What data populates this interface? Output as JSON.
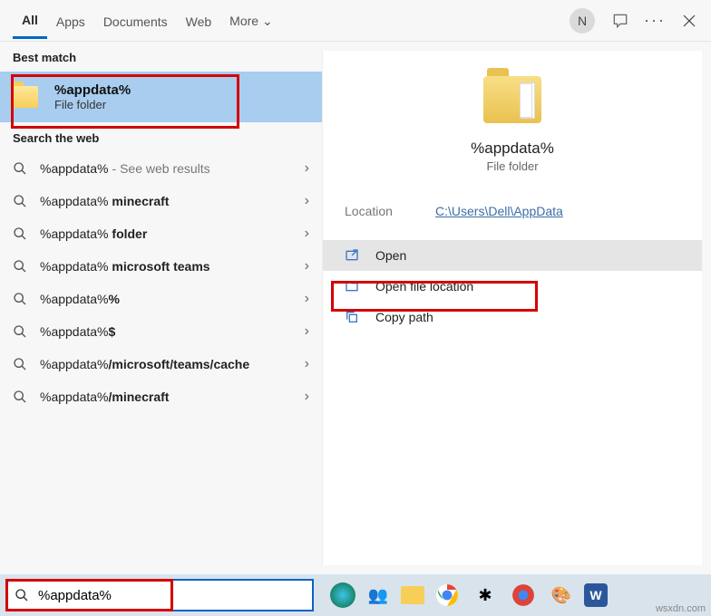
{
  "tabs": {
    "all": "All",
    "apps": "Apps",
    "docs": "Documents",
    "web": "Web",
    "more": "More"
  },
  "user_initial": "N",
  "sections": {
    "best": "Best match",
    "web": "Search the web"
  },
  "best": {
    "title": "%appdata%",
    "subtitle": "File folder"
  },
  "web_items": [
    {
      "text": "%appdata%",
      "hint": " - See web results"
    },
    {
      "text": "%appdata% ",
      "bold": "minecraft"
    },
    {
      "text": "%appdata% ",
      "bold": "folder"
    },
    {
      "text": "%appdata% ",
      "bold": "microsoft teams"
    },
    {
      "text": "%appdata%",
      "bold": "%"
    },
    {
      "text": "%appdata%",
      "bold": "$"
    },
    {
      "text": "%appdata%",
      "bold": "/microsoft/teams/cache"
    },
    {
      "text": "%appdata%",
      "bold": "/minecraft"
    }
  ],
  "preview": {
    "title": "%appdata%",
    "subtitle": "File folder",
    "location_label": "Location",
    "location_value": "C:\\Users\\Dell\\AppData"
  },
  "actions": {
    "open": "Open",
    "open_loc": "Open file location",
    "copy": "Copy path"
  },
  "search_value": "%appdata%",
  "watermark": "wsxdn.com"
}
